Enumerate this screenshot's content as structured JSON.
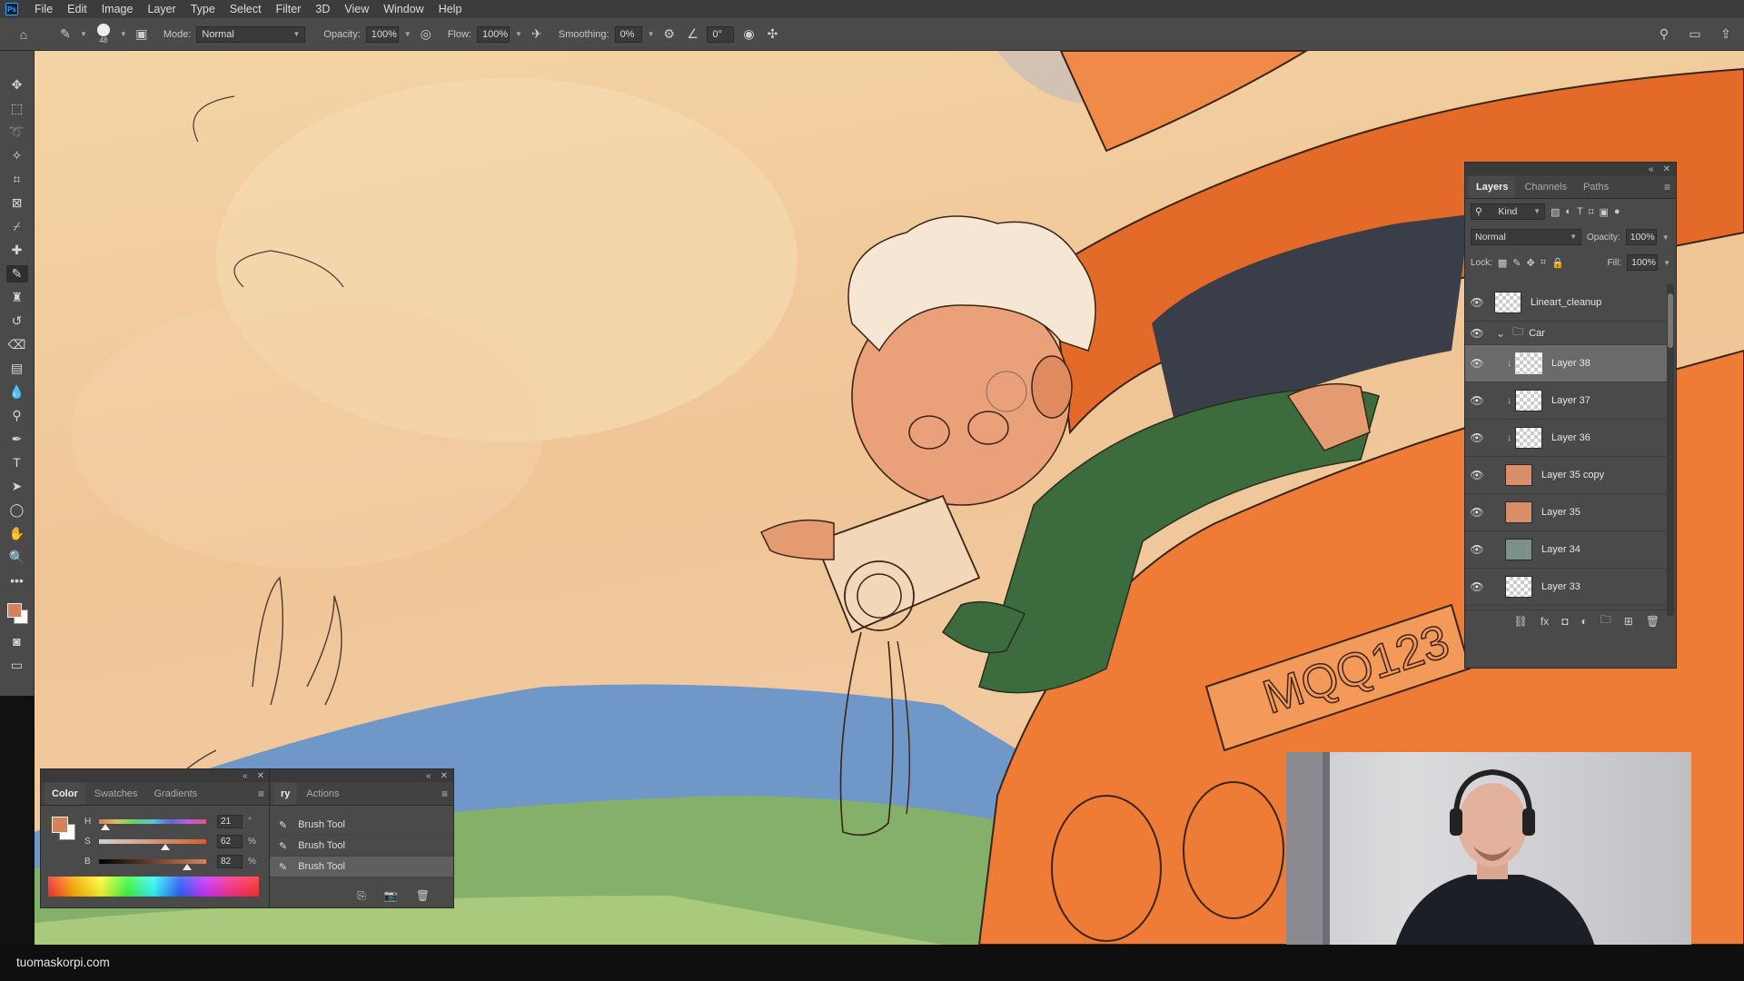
{
  "menu": [
    "File",
    "Edit",
    "Image",
    "Layer",
    "Type",
    "Select",
    "Filter",
    "3D",
    "View",
    "Window",
    "Help"
  ],
  "options": {
    "brush_size": "48",
    "mode_label": "Mode:",
    "mode_value": "Normal",
    "opacity_label": "Opacity:",
    "opacity_value": "100%",
    "flow_label": "Flow:",
    "flow_value": "100%",
    "smoothing_label": "Smoothing:",
    "smoothing_value": "0%",
    "angle_value": "0°"
  },
  "layers_panel": {
    "tabs": [
      "Layers",
      "Channels",
      "Paths"
    ],
    "filter_value": "Kind",
    "blend_mode": "Normal",
    "opacity_label": "Opacity:",
    "opacity_value": "100%",
    "lock_label": "Lock:",
    "fill_label": "Fill:",
    "fill_value": "100%",
    "layers": [
      {
        "name": "Lineart_cleanup",
        "type": "layer"
      },
      {
        "name": "Car",
        "type": "group"
      },
      {
        "name": "Layer 38",
        "type": "clipped",
        "selected": true
      },
      {
        "name": "Layer 37",
        "type": "clipped"
      },
      {
        "name": "Layer 36",
        "type": "clipped"
      },
      {
        "name": "Layer 35 copy",
        "type": "layer"
      },
      {
        "name": "Layer 35",
        "type": "layer"
      },
      {
        "name": "Layer 34",
        "type": "layer"
      },
      {
        "name": "Layer 33",
        "type": "layer"
      }
    ]
  },
  "color_panel": {
    "tabs": [
      "Color",
      "Swatches",
      "Gradients"
    ],
    "fg_color": "#d4825a",
    "h_label": "H",
    "h_value": "21",
    "h_unit": "°",
    "h_pos": 0.06,
    "s_label": "S",
    "s_value": "62",
    "s_unit": "%",
    "s_pos": 0.62,
    "b_label": "B",
    "b_value": "82",
    "b_unit": "%",
    "b_pos": 0.82
  },
  "history_panel": {
    "tabs": [
      "ry",
      "Actions"
    ],
    "items": [
      "Brush Tool",
      "Brush Tool",
      "Brush Tool"
    ]
  },
  "watermark": "tuomaskorpi.com"
}
